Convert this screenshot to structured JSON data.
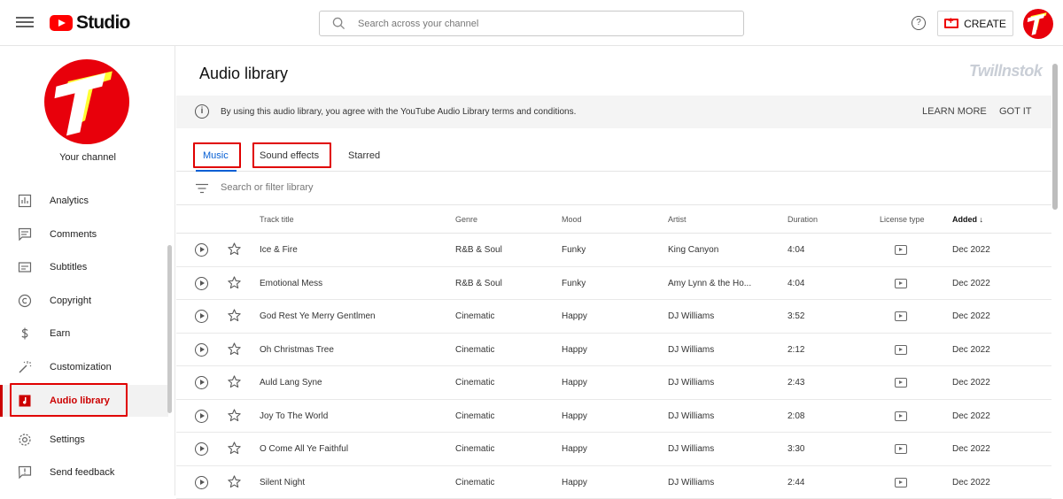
{
  "header": {
    "brand": "Studio",
    "search_placeholder": "Search across your channel",
    "help_glyph": "?",
    "create_label": "CREATE"
  },
  "sidebar": {
    "channel_label": "Your channel",
    "items": [
      {
        "label": "Analytics",
        "icon": "analytics-icon"
      },
      {
        "label": "Comments",
        "icon": "comments-icon"
      },
      {
        "label": "Subtitles",
        "icon": "subtitles-icon"
      },
      {
        "label": "Copyright",
        "icon": "copyright-icon"
      },
      {
        "label": "Earn",
        "icon": "dollar-icon"
      },
      {
        "label": "Customization",
        "icon": "magic-wand-icon"
      },
      {
        "label": "Audio library",
        "icon": "music-note-icon",
        "active": true
      },
      {
        "label": "Settings",
        "icon": "gear-icon"
      },
      {
        "label": "Send feedback",
        "icon": "feedback-icon"
      }
    ]
  },
  "main": {
    "title": "Audio library",
    "watermark": "Twillnstok",
    "notice": {
      "info_glyph": "i",
      "text": "By using this audio library, you agree with the YouTube Audio Library terms and conditions.",
      "learn_more": "LEARN MORE",
      "got_it": "GOT IT"
    },
    "tabs": [
      {
        "label": "Music",
        "active": true
      },
      {
        "label": "Sound effects"
      },
      {
        "label": "Starred"
      }
    ],
    "filter_placeholder": "Search or filter library",
    "columns": {
      "track_title": "Track title",
      "genre": "Genre",
      "mood": "Mood",
      "artist": "Artist",
      "duration": "Duration",
      "license_type": "License type",
      "added": "Added ↓"
    },
    "tracks": [
      {
        "title": "Ice & Fire",
        "genre": "R&B & Soul",
        "mood": "Funky",
        "artist": "King Canyon",
        "duration": "4:04",
        "added": "Dec 2022"
      },
      {
        "title": "Emotional Mess",
        "genre": "R&B & Soul",
        "mood": "Funky",
        "artist": "Amy Lynn & the Ho...",
        "duration": "4:04",
        "added": "Dec 2022"
      },
      {
        "title": "God Rest Ye Merry Gentlmen",
        "genre": "Cinematic",
        "mood": "Happy",
        "artist": "DJ Williams",
        "duration": "3:52",
        "added": "Dec 2022"
      },
      {
        "title": "Oh Christmas Tree",
        "genre": "Cinematic",
        "mood": "Happy",
        "artist": "DJ Williams",
        "duration": "2:12",
        "added": "Dec 2022"
      },
      {
        "title": "Auld Lang Syne",
        "genre": "Cinematic",
        "mood": "Happy",
        "artist": "DJ Williams",
        "duration": "2:43",
        "added": "Dec 2022"
      },
      {
        "title": "Joy To The World",
        "genre": "Cinematic",
        "mood": "Happy",
        "artist": "DJ Williams",
        "duration": "2:08",
        "added": "Dec 2022"
      },
      {
        "title": "O Come All Ye Faithful",
        "genre": "Cinematic",
        "mood": "Happy",
        "artist": "DJ Williams",
        "duration": "3:30",
        "added": "Dec 2022"
      },
      {
        "title": "Silent Night",
        "genre": "Cinematic",
        "mood": "Happy",
        "artist": "DJ Williams",
        "duration": "2:44",
        "added": "Dec 2022"
      }
    ]
  },
  "colors": {
    "accent": "#065fd4",
    "brand_red": "#ff0000",
    "highlight_red": "#e00000"
  }
}
